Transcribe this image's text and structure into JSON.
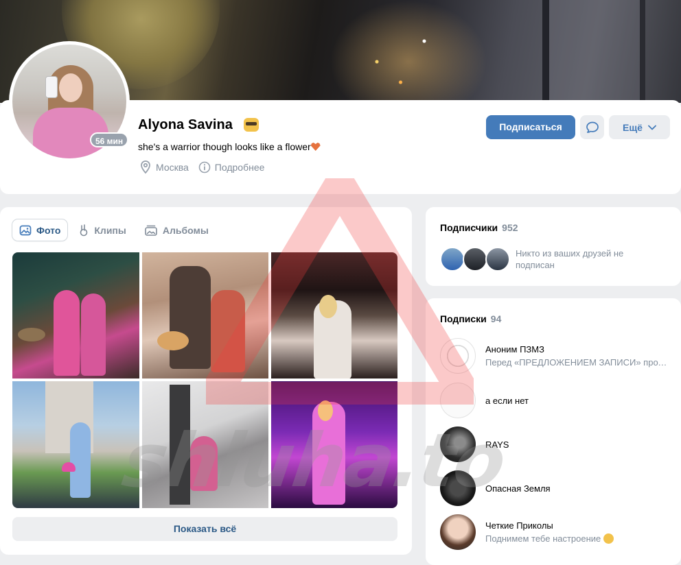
{
  "profile": {
    "name": "Alyona Savina",
    "status": "she's a warrior though looks like a flower",
    "online": "56 мин",
    "city": "Москва",
    "details": "Подробнее"
  },
  "actions": {
    "subscribe": "Подписаться",
    "more": "Ещё"
  },
  "photos": {
    "tabs": [
      "Фото",
      "Клипы",
      "Альбомы"
    ],
    "show_all": "Показать всё"
  },
  "followers": {
    "title": "Подписчики",
    "count": "952",
    "note": "Никто из ваших друзей не подписан"
  },
  "subscriptions": {
    "title": "Подписки",
    "count": "94",
    "items": [
      {
        "name": "Аноним ПЗМЗ",
        "desc": "Перед «ПРЕДЛОЖЕНИЕМ ЗАПИСИ» прочитайте правила"
      },
      {
        "name": "а если нет",
        "desc": ""
      },
      {
        "name": "RAYS",
        "desc": ""
      },
      {
        "name": "Опасная Земля",
        "desc": ""
      },
      {
        "name": "Четкие Приколы",
        "desc": "Поднимем тебе настроение"
      }
    ]
  },
  "watermark": "shluha.to",
  "colors": {
    "accent": "#447bba",
    "link": "#2a5885",
    "muted": "#818c99",
    "background": "#edeef0"
  }
}
